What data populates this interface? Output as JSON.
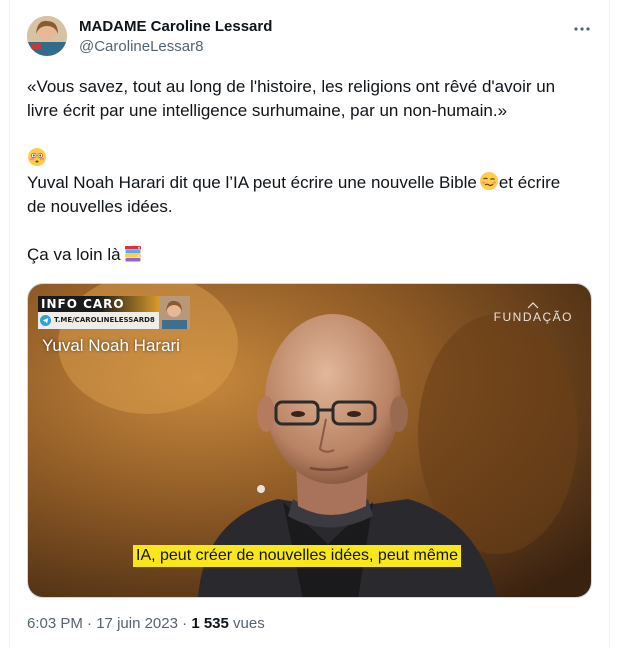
{
  "author": {
    "display_name": "MADAME Caroline Lessard",
    "handle": "@CarolineLessar8"
  },
  "tweet": {
    "line1": "«Vous savez, tout au long de l'histoire, les religions ont rêvé d'avoir un",
    "line2": "livre écrit par une intelligence surhumaine, par un non-humain.»",
    "line3": "Yuval Noah Harari dit que l’IA peut écrire une nouvelle Bible",
    "line3_tail": "et écrire",
    "line4": "de nouvelles idées.",
    "line5": "Ça va loin là"
  },
  "emojis": {
    "flushed": "flushed-face",
    "woozy": "woozy-face",
    "books": "books"
  },
  "media": {
    "banner_title": "INFO CARO",
    "banner_link": "T.ME/CAROLINELESSARD8",
    "caption_name": "Yuval Noah Harari",
    "brand_name": "FUNDAÇÃO",
    "subtitle": "IA, peut créer de nouvelles idées, peut même"
  },
  "meta": {
    "time": "6:03 PM",
    "date": "17 juin 2023",
    "sep": "·",
    "views_count": "1 535",
    "views_label": "vues"
  },
  "colors": {
    "text": "#0f1419",
    "secondary": "#536471",
    "subtitle_bg": "#f8e71c"
  }
}
